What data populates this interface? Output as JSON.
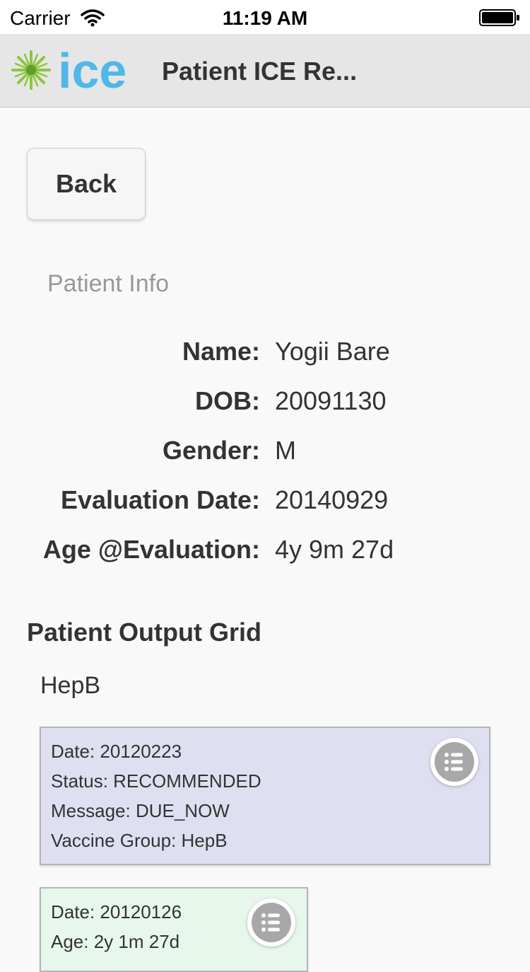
{
  "status_bar": {
    "carrier": "Carrier",
    "time": "11:19 AM"
  },
  "header": {
    "logo_text": "ice",
    "title": "Patient ICE Re..."
  },
  "back_button": {
    "label": "Back"
  },
  "patient_info": {
    "section_label": "Patient Info",
    "fields": [
      {
        "key": "Name:",
        "value": "Yogii Bare"
      },
      {
        "key": "DOB:",
        "value": "20091130"
      },
      {
        "key": "Gender:",
        "value": "M"
      },
      {
        "key": "Evaluation Date:",
        "value": "20140929"
      },
      {
        "key": "Age @Evaluation:",
        "value": "4y 9m 27d"
      }
    ]
  },
  "output_grid": {
    "title": "Patient Output Grid",
    "group_label": "HepB",
    "cards": [
      {
        "lines": [
          "Date: 20120223",
          "Status: RECOMMENDED",
          "Message: DUE_NOW",
          "Vaccine Group: HepB"
        ],
        "color": "#dedff1"
      },
      {
        "lines": [
          "Date: 20120126",
          "Age: 2y 1m 27d"
        ],
        "color": "#e7f7ec"
      }
    ]
  },
  "colors": {
    "logo_blue": "#4fb8e8",
    "logo_green": "#8cc63f",
    "header_bg": "#e6e6e6"
  }
}
